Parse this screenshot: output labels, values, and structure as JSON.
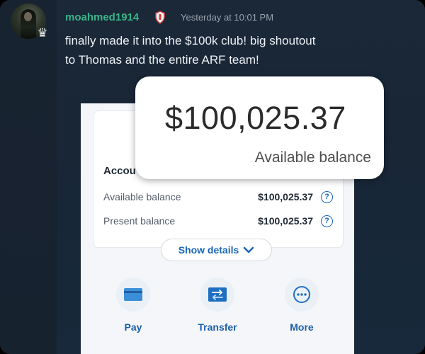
{
  "post": {
    "username": "moahmed1914",
    "timestamp": "Yesterday at 10:01 PM",
    "message_lines": [
      "finally made it into the $100k club! big shoutout",
      "to Thomas and the entire ARF team!"
    ],
    "username_color": "#39b48a"
  },
  "icons": {
    "avatar": "profile-avatar",
    "crown": "crown-icon",
    "role_badge": "shield-badge-icon"
  },
  "zoomed_balance": {
    "amount": "$100,025.37",
    "label": "Available balance"
  },
  "account_card": {
    "title": "Accou",
    "rows": [
      {
        "label": "Available balance",
        "value": "$100,025.37",
        "help": "?"
      },
      {
        "label": "Present balance",
        "value": "$100,025.37",
        "help": "?"
      }
    ],
    "show_details": "Show details"
  },
  "actions": [
    {
      "label": "Pay",
      "icon": "card-icon"
    },
    {
      "label": "Transfer",
      "icon": "transfer-icon"
    },
    {
      "label": "More",
      "icon": "more-icon"
    }
  ]
}
